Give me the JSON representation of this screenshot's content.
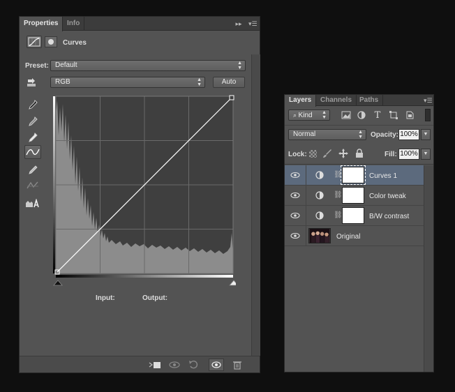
{
  "properties_panel": {
    "tabs": [
      {
        "label": "Properties",
        "active": true
      },
      {
        "label": "Info",
        "active": false
      }
    ],
    "adjustment_name": "Curves",
    "preset_label": "Preset:",
    "preset_value": "Default",
    "channel_value": "RGB",
    "auto_label": "Auto",
    "input_label": "Input:",
    "output_label": "Output:",
    "tools": [
      "on-image-adjust-icon",
      "black-point-eyedropper-icon",
      "gray-point-eyedropper-icon",
      "white-point-eyedropper-icon",
      "curve-points-icon",
      "pencil-draw-icon",
      "smooth-curve-icon",
      "clipping-warning-icon"
    ],
    "footer_buttons": [
      "clip-to-layer-icon",
      "view-previous-icon",
      "reset-icon",
      "visibility-eye-icon",
      "trash-icon"
    ]
  },
  "layers_panel": {
    "tabs": [
      {
        "label": "Layers",
        "active": true
      },
      {
        "label": "Channels",
        "active": false
      },
      {
        "label": "Paths",
        "active": false
      }
    ],
    "filter_kind": "Kind",
    "blend_mode": "Normal",
    "opacity_label": "Opacity:",
    "opacity_value": "100%",
    "lock_label": "Lock:",
    "fill_label": "Fill:",
    "fill_value": "100%",
    "layers": [
      {
        "name": "Curves 1",
        "type": "adjustment",
        "selected": true
      },
      {
        "name": "Color tweak",
        "type": "adjustment",
        "selected": false
      },
      {
        "name": "B/W contrast",
        "type": "adjustment",
        "selected": false
      },
      {
        "name": "Original",
        "type": "image",
        "selected": false
      }
    ]
  },
  "colors": {
    "panel_bg": "#535353",
    "graph_bg": "#3f3f3f",
    "histogram": "#8a8a8a",
    "selected_layer": "#5c6a7d"
  }
}
